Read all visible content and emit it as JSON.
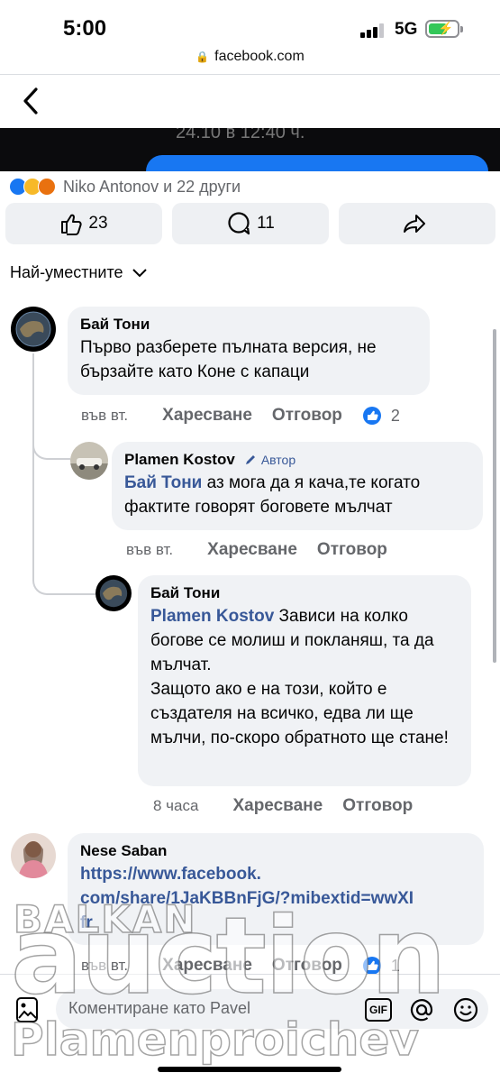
{
  "status_bar": {
    "time": "5:00",
    "network": "5G",
    "url": "facebook.com"
  },
  "media": {
    "caption": "24.10 в 12:40 ч."
  },
  "reactions": {
    "summary": "Niko Antonov и 22 други",
    "types": [
      "like-icon",
      "sad-icon",
      "angry-icon"
    ]
  },
  "actions": {
    "likes": "23",
    "comments": "11"
  },
  "sort": {
    "label": "Най-уместните"
  },
  "comments": [
    {
      "name": "Бай Тони",
      "text": "Първо разберете пълната версия, не бързайте като Коне с капаци",
      "time": "във вт.",
      "like": "Харесване",
      "reply": "Отговор",
      "reaction_count": "2"
    },
    {
      "name": "Plamen Kostov",
      "badge": "Автор",
      "mention": "Бай Тони",
      "text": " аз мога да я кача,те когато фактите говорят боговете мълчат",
      "time": "във вт.",
      "like": "Харесване",
      "reply": "Отговор"
    },
    {
      "name": "Бай Тони",
      "mention": "Plamen Kostov",
      "text": " Зависи на колко богове се молиш и покланяш, та да мълчат.",
      "text2": "Защото ако е на този, който е създателя на всичко, едва ли ще мълчи, по-скоро обратното ще стане!",
      "time": "8 часа",
      "like": "Харесване",
      "reply": "Отговор"
    },
    {
      "name": "Nese Saban",
      "link": "https://www.facebook.com/share/1JaKBBnFjG/?mibextid=wwXIfr",
      "link_lines": [
        "https://www.facebook.",
        "com/share/1JaKBBnFjG/?mibextid=wwXI",
        "fr"
      ],
      "time": "във вт.",
      "like": "Харесване",
      "reply": "Отговор",
      "reaction_count": "1"
    }
  ],
  "composer": {
    "placeholder": "Коментиране като Pavel",
    "gif_label": "GIF"
  },
  "watermark": {
    "line1": "BALKAN",
    "line2": "auction",
    "line3": "Plamenproichev"
  },
  "colors": {
    "accent": "#1877f2",
    "link": "#385898",
    "bubble": "#f0f2f5",
    "muted": "#65676b"
  }
}
